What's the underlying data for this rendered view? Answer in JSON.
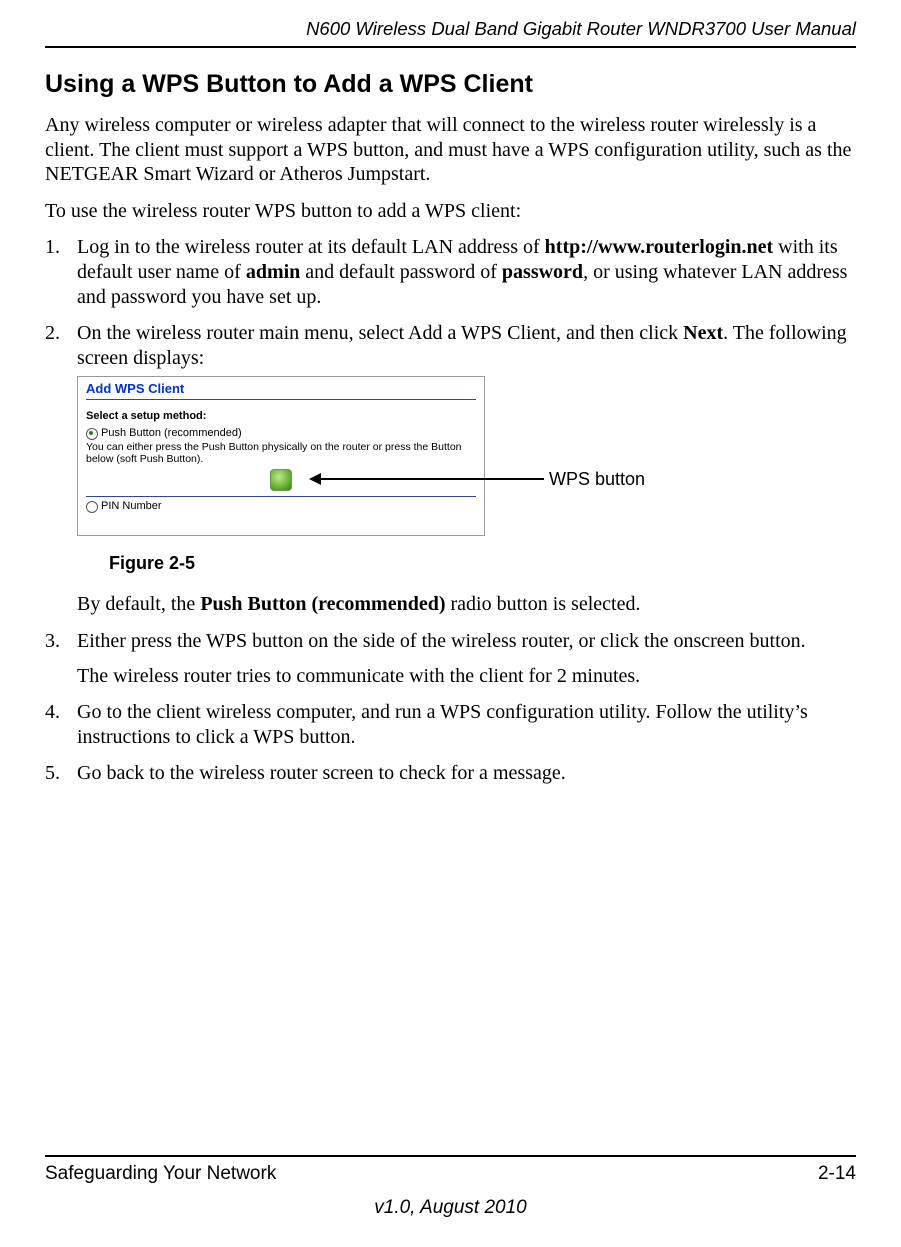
{
  "header": {
    "doc_title": "N600 Wireless Dual Band Gigabit Router WNDR3700 User Manual"
  },
  "section": {
    "heading": "Using a WPS Button to Add a WPS Client"
  },
  "intro": {
    "p1": "Any wireless computer or wireless adapter that will connect to the wireless router wirelessly is a client. The client must support a WPS button, and must have a WPS configuration utility, such as the NETGEAR Smart Wizard or Atheros Jumpstart.",
    "p2": "To use the wireless router WPS button to add a WPS client:"
  },
  "steps": {
    "s1": {
      "pre": "Log in to the wireless router at its default LAN address of ",
      "b1": "http://www.routerlogin.net",
      "mid1": " with its default user name of ",
      "b2": "admin",
      "mid2": " and default password of ",
      "b3": "password",
      "post": ", or using whatever LAN address and password you have set up."
    },
    "s2": {
      "pre": "On the wireless router main menu, select Add a WPS Client, and then click ",
      "b1": "Next",
      "post": ". The following screen displays:"
    },
    "s2_note": {
      "pre": "By default, the ",
      "b1": "Push Button (recommended)",
      "post": " radio button is selected."
    },
    "s3": {
      "line1": "Either press the WPS button on the side of the wireless router, or click the onscreen button.",
      "line2": "The wireless router tries to communicate with the client for 2 minutes."
    },
    "s4": "Go to the client wireless computer, and run a WPS configuration utility. Follow the utility’s instructions to click a WPS button.",
    "s5": "Go back to the wireless router screen to check for a message."
  },
  "figure": {
    "caption": "Figure 2-5",
    "callout": "WPS button",
    "screenshot": {
      "title": "Add WPS Client",
      "select_label": "Select a setup method:",
      "opt1": "Push Button (recommended)",
      "opt1_desc": "You can either press the Push Button physically on the router or press the Button below (soft Push Button).",
      "opt2": "PIN Number"
    }
  },
  "footer": {
    "section": "Safeguarding Your Network",
    "page": "2-14",
    "version": "v1.0, August 2010"
  }
}
